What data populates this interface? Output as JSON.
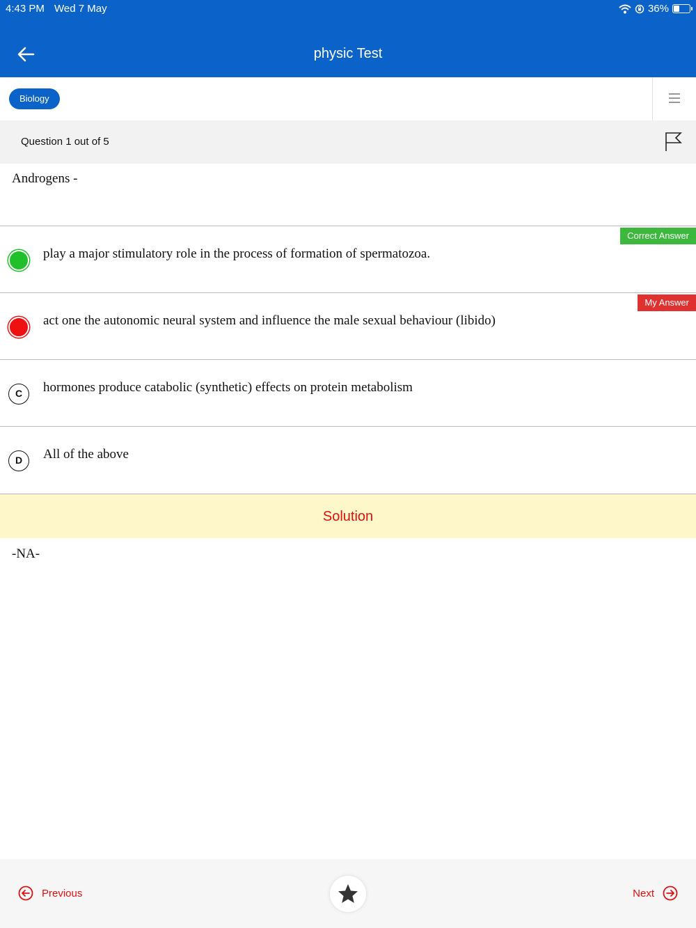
{
  "status_bar": {
    "time": "4:43 PM",
    "date": "Wed 7 May",
    "battery": "36%"
  },
  "header": {
    "title": "physic Test"
  },
  "subject": {
    "label": "Biology"
  },
  "question_bar": {
    "count": "Question 1 out of 5"
  },
  "question": {
    "text": "Androgens -"
  },
  "options": [
    {
      "marker": "correct",
      "text": "play a major stimulatory role in the process of formation of spermatozoa.",
      "badge": "Correct Answer"
    },
    {
      "marker": "wrong",
      "text": "act one the autonomic neural system and influence the male sexual behaviour (libido)",
      "badge": "My Answer"
    },
    {
      "marker": "C",
      "text": "hormones produce catabolic (synthetic) effects on protein metabolism"
    },
    {
      "marker": "D",
      "text": "All of the above"
    }
  ],
  "solution": {
    "label": "Solution",
    "text": "-NA-"
  },
  "footer": {
    "previous_label": "Previous",
    "next_label": "Next"
  },
  "colors": {
    "primary": "#0b63c9",
    "correct": "#20c02a",
    "wrong": "#ee1111",
    "accent": "#e01010",
    "solution_bg": "#fdf7c9"
  }
}
